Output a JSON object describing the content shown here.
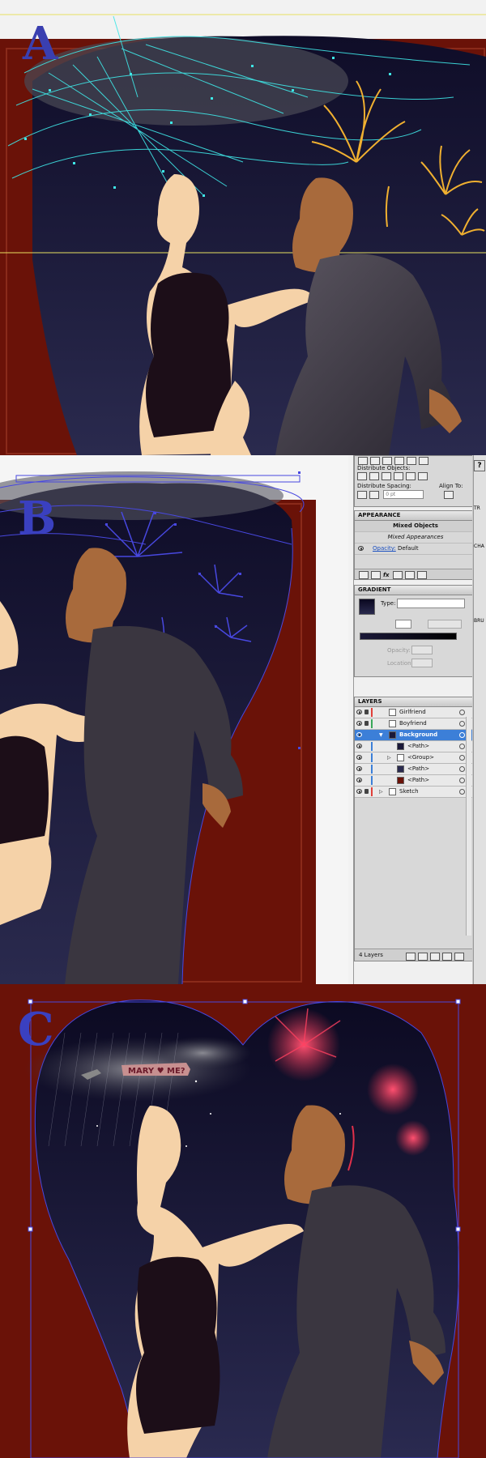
{
  "panels": [
    {
      "letter": "A"
    },
    {
      "letter": "B"
    },
    {
      "letter": "C"
    }
  ],
  "align_panel": {
    "distribute_objects_label": "Distribute Objects:",
    "distribute_spacing_label": "Distribute Spacing:",
    "align_to_label": "Align To:",
    "spacing_value": "0 pt"
  },
  "appearance_panel": {
    "tab_label": "APPEARANCE",
    "mixed_objects": "Mixed Objects",
    "mixed_appearances": "Mixed Appearances",
    "opacity_label": "Opacity:",
    "opacity_value": "Default"
  },
  "gradient_panel": {
    "tab_label": "GRADIENT",
    "type_label": "Type:",
    "opacity_label": "Opacity:",
    "location_label": "Location:"
  },
  "layers_panel": {
    "tab_label": "LAYERS",
    "rows": [
      {
        "name": "Girlfriend",
        "color": "#e0403a"
      },
      {
        "name": "Boyfriend",
        "color": "#3aa85a"
      },
      {
        "name": "Background",
        "color": "#3c7fd8"
      },
      {
        "name": "<Path>",
        "color": "#3c7fd8"
      },
      {
        "name": "<Group>",
        "color": "#3c7fd8"
      },
      {
        "name": "<Path>",
        "color": "#3c7fd8"
      },
      {
        "name": "<Path>",
        "color": "#3c7fd8"
      },
      {
        "name": "Sketch",
        "color": "#e0403a"
      }
    ],
    "footer_count": "4 Layers"
  },
  "side_tabs": {
    "transform_tab": "TR",
    "character_tab": "CHA",
    "brushes_tab": "BRU"
  },
  "illustration": {
    "banner_text": "MARY ♥ ME?"
  },
  "colors": {
    "background_red": "#6a1208",
    "night_sky": "#1a1838",
    "selection_cyan": "#3fe6e6",
    "selection_blue": "#4848e0",
    "firework_gold": "#f0b030",
    "firework_red": "#e0304a",
    "guide_yellow": "#e8e060"
  }
}
